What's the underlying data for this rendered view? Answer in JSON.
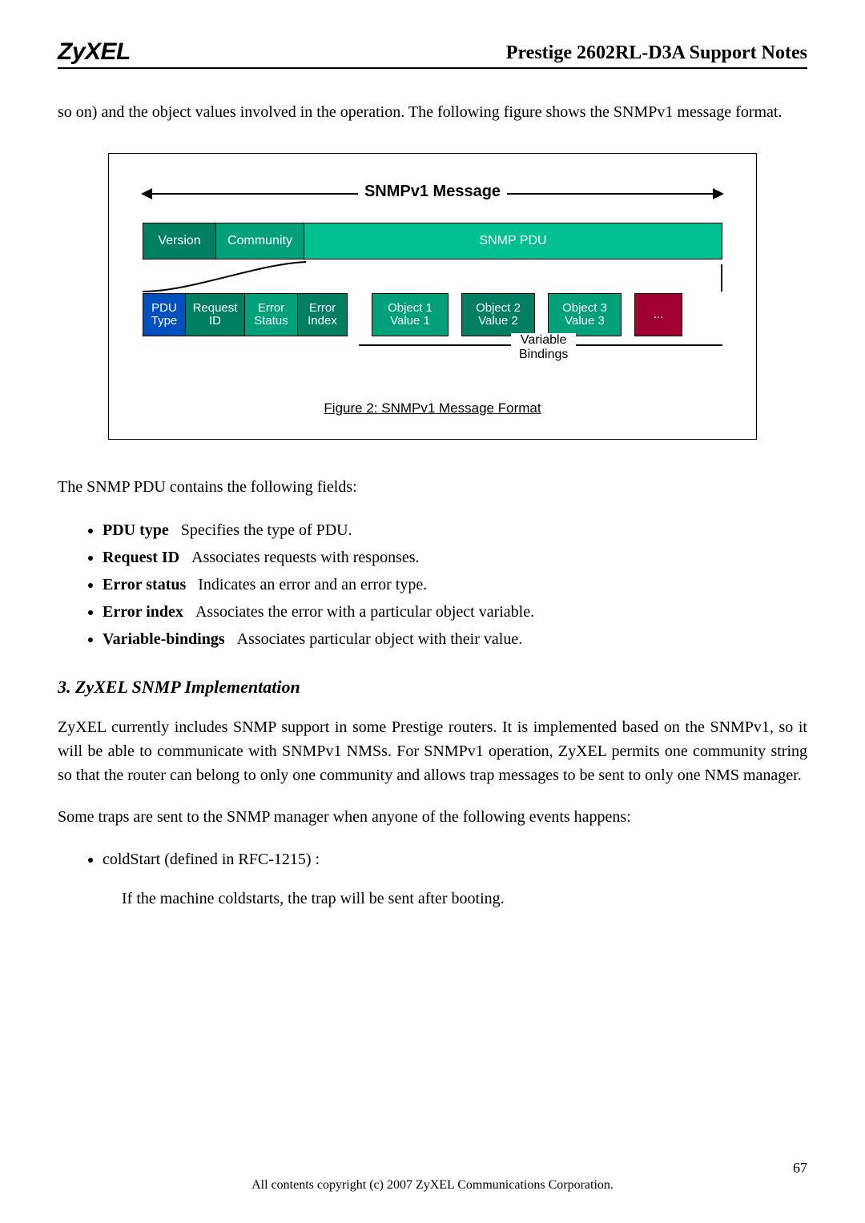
{
  "header": {
    "logo": "ZyXEL",
    "title": "Prestige 2602RL-D3A Support Notes"
  },
  "intro": "so on) and the object values involved in the operation. The following figure shows the SNMPv1 message format.",
  "figure": {
    "snmp_message_label": "SNMPv1 Message",
    "row1": {
      "version": "Version",
      "community": "Community",
      "snmp_pdu": "SNMP PDU"
    },
    "row2": {
      "pdu_type_l1": "PDU",
      "pdu_type_l2": "Type",
      "request_id_l1": "Request",
      "request_id_l2": "ID",
      "error_status_l1": "Error",
      "error_status_l2": "Status",
      "error_index_l1": "Error",
      "error_index_l2": "Index",
      "obj1_l1": "Object 1",
      "obj1_l2": "Value 1",
      "obj2_l1": "Object 2",
      "obj2_l2": "Value 2",
      "obj3_l1": "Object 3",
      "obj3_l2": "Value 3",
      "dots": "..."
    },
    "variable_bindings_l1": "Variable",
    "variable_bindings_l2": "Bindings",
    "caption": "Figure 2: SNMPv1 Message Format"
  },
  "pdu_intro": "The SNMP PDU contains the following fields:",
  "pdu_fields": [
    {
      "term": "PDU type",
      "desc": "Specifies the type of PDU."
    },
    {
      "term": "Request ID",
      "desc": "Associates requests with responses."
    },
    {
      "term": "Error status",
      "desc": "Indicates an error and an error type."
    },
    {
      "term": "Error index",
      "desc": "Associates the error with a particular object variable."
    },
    {
      "term": "Variable-bindings",
      "desc": "Associates particular object with their value."
    }
  ],
  "section3": {
    "heading": "3. ZyXEL SNMP Implementation",
    "p1": "ZyXEL currently includes SNMP support in some Prestige routers. It is implemented based on the SNMPv1, so it will be able to communicate with SNMPv1 NMSs.   For SNMPv1 operation, ZyXEL permits one community string so that the router can belong to only one community and allows trap messages to be sent to only one NMS manager.",
    "p2": "Some traps are sent to the SNMP manager when anyone of the following events happens:",
    "trap1": "coldStart (defined in RFC-1215) :",
    "trap1_desc": "If the machine coldstarts, the trap will be sent after booting."
  },
  "footer": "All contents copyright (c) 2007 ZyXEL Communications Corporation.",
  "page_number": "67"
}
